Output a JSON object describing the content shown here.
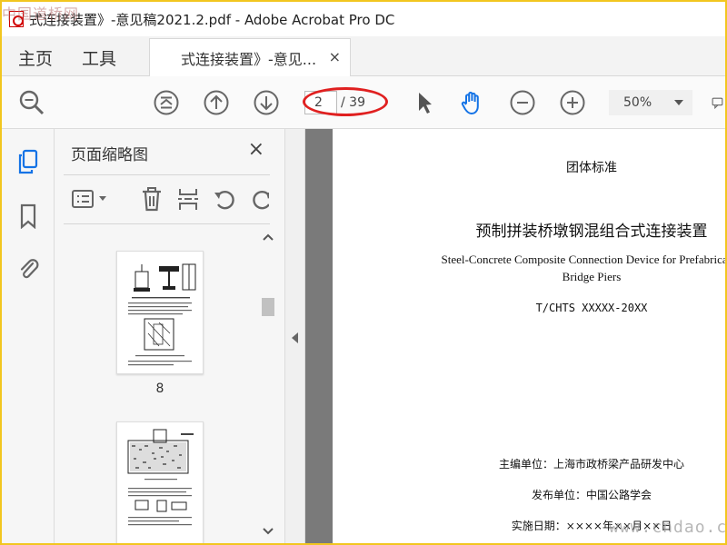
{
  "window": {
    "title": "式连接装置》-意见稿2021.2.pdf - Adobe Acrobat Pro DC",
    "watermark_top": "中国道桥网",
    "watermark_bottom": "www.cndao.com"
  },
  "tabs": {
    "home": "主页",
    "tools": "工具",
    "document": "式连接装置》-意见...",
    "close_glyph": "×"
  },
  "toolbar": {
    "current_page": "2",
    "total_pages": "/ 39",
    "zoom": "50%"
  },
  "side_panel": {
    "title": "页面缩略图",
    "close_glyph": "×",
    "thumbnails": [
      {
        "label": "8"
      },
      {
        "label": ""
      }
    ]
  },
  "document": {
    "doc_type": "团体标准",
    "title_cn": "预制拼装桥墩钢混组合式连接装置",
    "title_en_line1": "Steel-Concrete Composite Connection Device for Prefabricated",
    "title_en_line2": "Bridge Piers",
    "code": "T/CHTS XXXXX-20XX",
    "editor": "主编单位：上海市政桥梁产品研发中心",
    "publisher": "发布单位：中国公路学会",
    "effective_date": "实施日期：××××年××月××日"
  },
  "colors": {
    "annotation_oval": "#e02020",
    "border": "#f2c61f",
    "hand_tool": "#1473e6"
  }
}
